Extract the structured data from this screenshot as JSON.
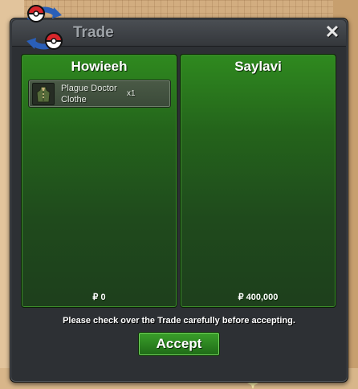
{
  "window": {
    "title": "Trade",
    "close_label": "✕",
    "accent_color": "#2f8a1f"
  },
  "traders": {
    "left": {
      "name": "Howieeh",
      "money": "₽ 0",
      "items": [
        {
          "name": "Plague Doctor Clothe",
          "quantity": "x1",
          "icon": "clothing-icon"
        }
      ]
    },
    "right": {
      "name": "Saylavi",
      "money": "₽ 400,000",
      "items": []
    }
  },
  "notice": "Please check over the Trade carefully before accepting.",
  "accept_label": "Accept"
}
